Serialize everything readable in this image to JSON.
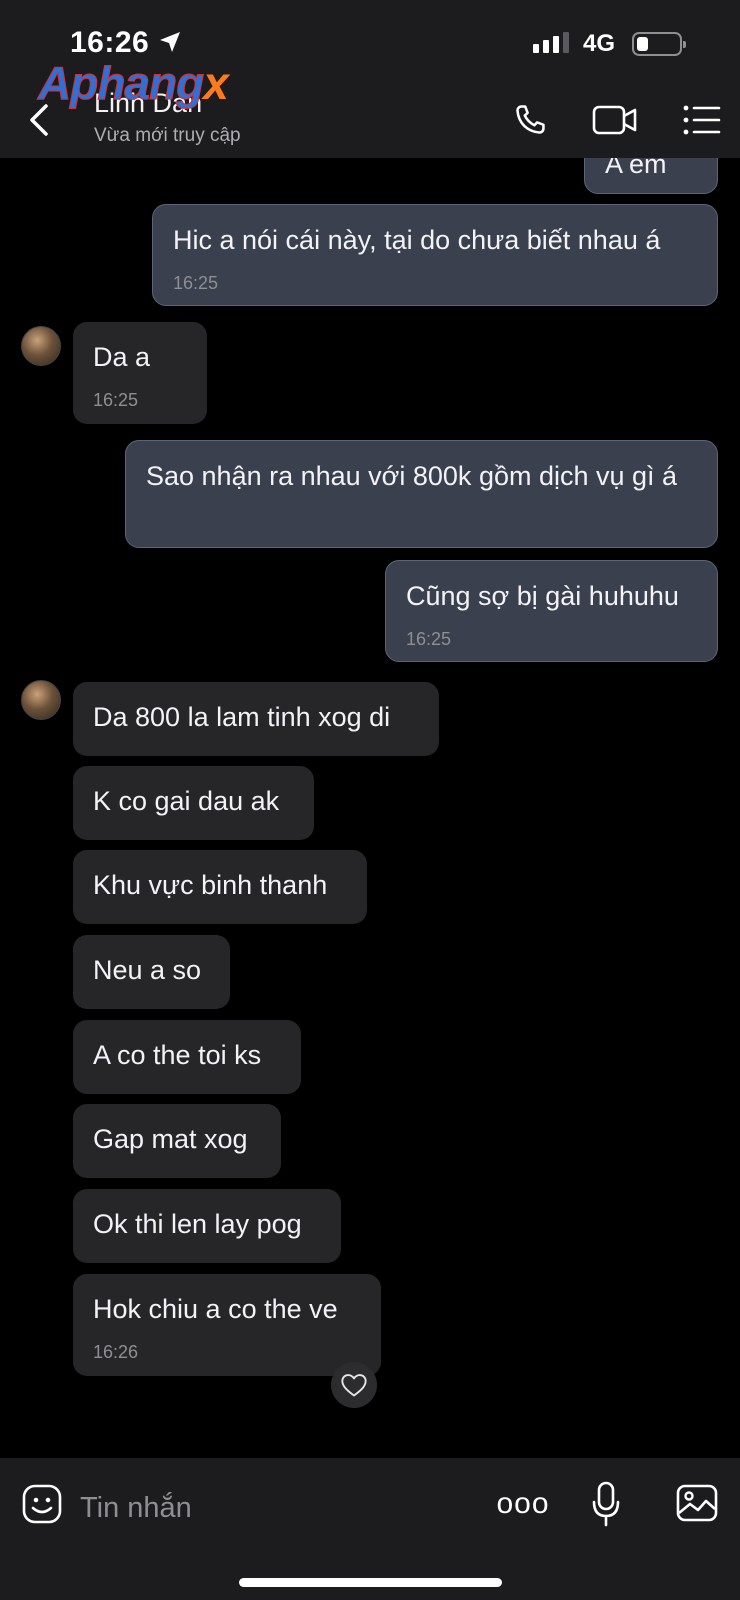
{
  "status_bar": {
    "time": "16:26",
    "network": "4G",
    "signal_bars": 4,
    "battery_level": 0.25
  },
  "watermark": {
    "main": "Aphang",
    "x": "x"
  },
  "header": {
    "contact_name": "Linh Dan",
    "contact_status": "Vừa mới truy cập"
  },
  "messages": [
    {
      "dir": "out",
      "text": "A em",
      "time": ""
    },
    {
      "dir": "out",
      "text": "Hic a nói cái này, tại do chưa biết nhau á",
      "time": "16:25"
    },
    {
      "dir": "in",
      "text": "Da a",
      "time": "16:25"
    },
    {
      "dir": "out",
      "text": "Sao nhận ra nhau với 800k gồm dịch vụ gì á",
      "time": ""
    },
    {
      "dir": "out",
      "text": "Cũng sợ bị gài huhuhu",
      "time": "16:25"
    },
    {
      "dir": "in",
      "text": "Da 800 la lam tinh xog di",
      "time": ""
    },
    {
      "dir": "in",
      "text": "K co gai dau ak",
      "time": ""
    },
    {
      "dir": "in",
      "text": "Khu vực binh thanh",
      "time": ""
    },
    {
      "dir": "in",
      "text": "Neu a so",
      "time": ""
    },
    {
      "dir": "in",
      "text": "A co the toi ks",
      "time": ""
    },
    {
      "dir": "in",
      "text": "Gap mat xog",
      "time": ""
    },
    {
      "dir": "in",
      "text": "Ok thi len lay pog",
      "time": ""
    },
    {
      "dir": "in",
      "text": "Hok chiu a co the ve",
      "time": "16:26"
    }
  ],
  "composer": {
    "placeholder": "Tin nhắn",
    "more_label": "ooo"
  },
  "icons": [
    "back-chevron-icon",
    "phone-icon",
    "video-camera-icon",
    "menu-list-icon",
    "heart-icon",
    "sticker-icon",
    "microphone-icon",
    "image-icon"
  ]
}
